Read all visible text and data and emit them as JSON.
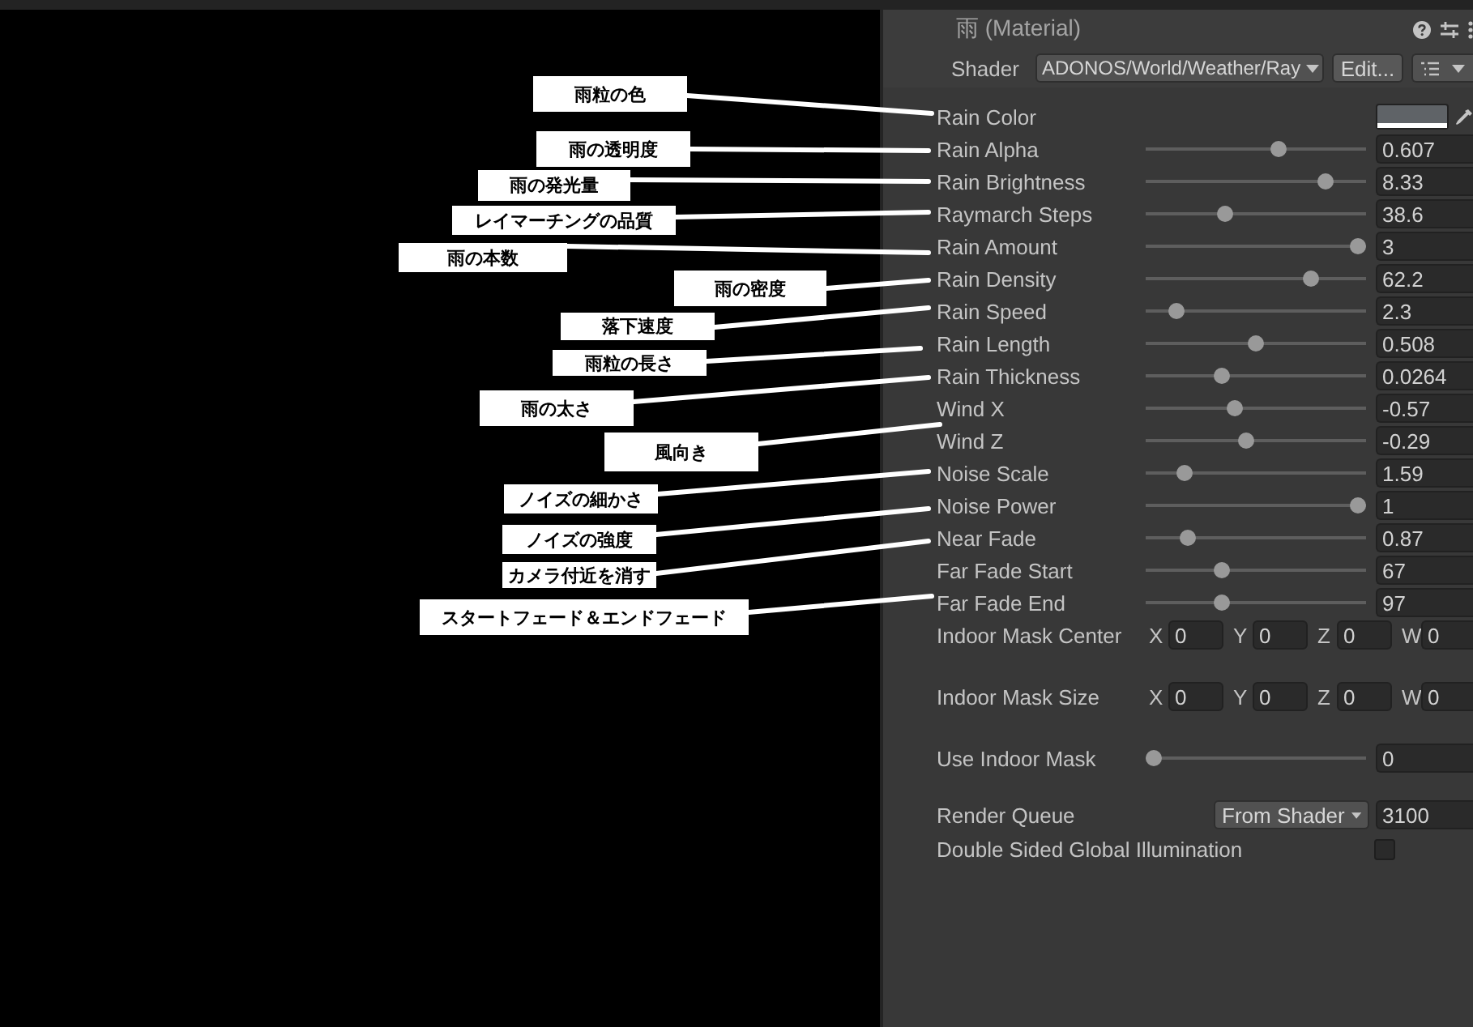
{
  "inspector": {
    "title": "雨 (Material)",
    "shader": {
      "label": "Shader",
      "value": "ADONOS/World/Weather/Ray",
      "edit_button": "Edit..."
    },
    "properties": [
      {
        "label": "Rain Color",
        "kind": "color",
        "color": "#5f6367",
        "annotation": "雨粒の色"
      },
      {
        "label": "Rain Alpha",
        "kind": "slider",
        "level": 0.61,
        "value": "0.607",
        "annotation": "雨の透明度"
      },
      {
        "label": "Rain Brightness",
        "kind": "slider",
        "level": 0.84,
        "value": "8.33",
        "annotation": "雨の発光量"
      },
      {
        "label": "Raymarch Steps",
        "kind": "slider",
        "level": 0.35,
        "value": "38.6",
        "annotation": "レイマーチングの品質"
      },
      {
        "label": "Rain Amount",
        "kind": "slider",
        "level": 1,
        "value": "3",
        "annotation": "雨の本数"
      },
      {
        "label": "Rain Density",
        "kind": "slider",
        "level": 0.77,
        "value": "62.2",
        "annotation": "雨の密度"
      },
      {
        "label": "Rain Speed",
        "kind": "slider",
        "level": 0.11,
        "value": "2.3",
        "annotation": "落下速度"
      },
      {
        "label": "Rain Length",
        "kind": "slider",
        "level": 0.5,
        "value": "0.508",
        "annotation": "雨粒の長さ"
      },
      {
        "label": "Rain Thickness",
        "kind": "slider",
        "level": 0.33,
        "value": "0.0264",
        "annotation": "雨の太さ"
      },
      {
        "label": "Wind X",
        "kind": "slider",
        "level": 0.4,
        "value": "-0.57"
      },
      {
        "label": "Wind Z",
        "kind": "slider",
        "level": 0.45,
        "value": "-0.29",
        "annotation": "風向き"
      },
      {
        "label": "Noise Scale",
        "kind": "slider",
        "level": 0.15,
        "value": "1.59",
        "annotation": "ノイズの細かさ"
      },
      {
        "label": "Noise Power",
        "kind": "slider",
        "level": 1,
        "value": "1",
        "annotation": "ノイズの強度"
      },
      {
        "label": "Near Fade",
        "kind": "slider",
        "level": 0.17,
        "value": "0.87",
        "annotation": "カメラ付近を消す"
      },
      {
        "label": "Far Fade Start",
        "kind": "slider",
        "level": 0.33,
        "value": "67"
      },
      {
        "label": "Far Fade End",
        "kind": "slider",
        "level": 0.33,
        "value": "97",
        "annotation": "スタートフェード＆エンドフェード"
      },
      {
        "label": "Indoor Mask Center",
        "kind": "vector",
        "components": [
          {
            "axis": "X",
            "value": "0"
          },
          {
            "axis": "Y",
            "value": "0"
          },
          {
            "axis": "Z",
            "value": "0"
          },
          {
            "axis": "W",
            "value": "0"
          }
        ]
      },
      {
        "label": "Indoor Mask Size",
        "kind": "vector",
        "components": [
          {
            "axis": "X",
            "value": "0"
          },
          {
            "axis": "Y",
            "value": "0"
          },
          {
            "axis": "Z",
            "value": "0"
          },
          {
            "axis": "W",
            "value": "0"
          }
        ]
      },
      {
        "label": "Use Indoor Mask",
        "kind": "slider",
        "level": 0,
        "value": "0"
      },
      {
        "label": "Render Queue",
        "kind": "dropdown",
        "option": "From Shader",
        "value": "3100"
      },
      {
        "label": "Double Sided Global Illumination",
        "kind": "checkbox",
        "checked": false
      }
    ]
  }
}
